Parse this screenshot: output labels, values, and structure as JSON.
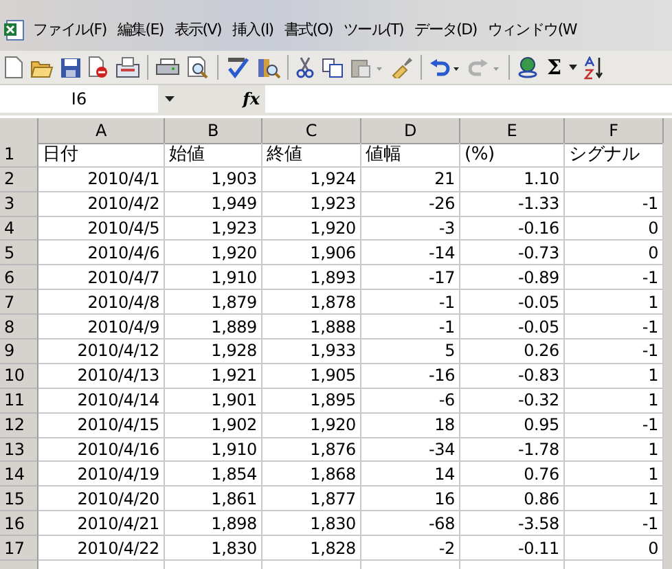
{
  "menu": {
    "items": [
      "ファイル(F)",
      "編集(E)",
      "表示(V)",
      "挿入(I)",
      "書式(O)",
      "ツール(T)",
      "データ(D)",
      "ウィンドウ(W"
    ]
  },
  "toolbar": {
    "autosum": "Σ"
  },
  "formula_bar": {
    "name_box": "I6",
    "fx_label": "fx"
  },
  "sheet": {
    "column_headers": [
      "A",
      "B",
      "C",
      "D",
      "E",
      "F"
    ],
    "rows": [
      {
        "number": "1",
        "cells": [
          "日付",
          "始値",
          "終値",
          "値幅",
          "(%)",
          "シグナル"
        ]
      },
      {
        "number": "2",
        "cells": [
          "2010/4/1",
          "1,903",
          "1,924",
          "21",
          "1.10"
        ]
      },
      {
        "number": "3",
        "cells": [
          "2010/4/2",
          "1,949",
          "1,923",
          "-26",
          "-1.33",
          "-1"
        ]
      },
      {
        "number": "4",
        "cells": [
          "2010/4/5",
          "1,923",
          "1,920",
          "-3",
          "-0.16",
          "0"
        ]
      },
      {
        "number": "5",
        "cells": [
          "2010/4/6",
          "1,920",
          "1,906",
          "-14",
          "-0.73",
          "0"
        ]
      },
      {
        "number": "6",
        "cells": [
          "2010/4/7",
          "1,910",
          "1,893",
          "-17",
          "-0.89",
          "-1"
        ]
      },
      {
        "number": "7",
        "cells": [
          "2010/4/8",
          "1,879",
          "1,878",
          "-1",
          "-0.05",
          "1"
        ]
      },
      {
        "number": "8",
        "cells": [
          "2010/4/9",
          "1,889",
          "1,888",
          "-1",
          "-0.05",
          "-1"
        ]
      },
      {
        "number": "9",
        "cells": [
          "2010/4/12",
          "1,928",
          "1,933",
          "5",
          "0.26",
          "-1"
        ]
      },
      {
        "number": "10",
        "cells": [
          "2010/4/13",
          "1,921",
          "1,905",
          "-16",
          "-0.83",
          "1"
        ]
      },
      {
        "number": "11",
        "cells": [
          "2010/4/14",
          "1,901",
          "1,895",
          "-6",
          "-0.32",
          "1"
        ]
      },
      {
        "number": "12",
        "cells": [
          "2010/4/15",
          "1,902",
          "1,920",
          "18",
          "0.95",
          "-1"
        ]
      },
      {
        "number": "13",
        "cells": [
          "2010/4/16",
          "1,910",
          "1,876",
          "-34",
          "-1.78",
          "1"
        ]
      },
      {
        "number": "14",
        "cells": [
          "2010/4/19",
          "1,854",
          "1,868",
          "14",
          "0.76",
          "1"
        ]
      },
      {
        "number": "15",
        "cells": [
          "2010/4/20",
          "1,861",
          "1,877",
          "16",
          "0.86",
          "1"
        ]
      },
      {
        "number": "16",
        "cells": [
          "2010/4/21",
          "1,898",
          "1,830",
          "-68",
          "-3.58",
          "-1"
        ]
      },
      {
        "number": "17",
        "cells": [
          "2010/4/22",
          "1,830",
          "1,828",
          "-2",
          "-0.11",
          "0"
        ]
      }
    ]
  }
}
